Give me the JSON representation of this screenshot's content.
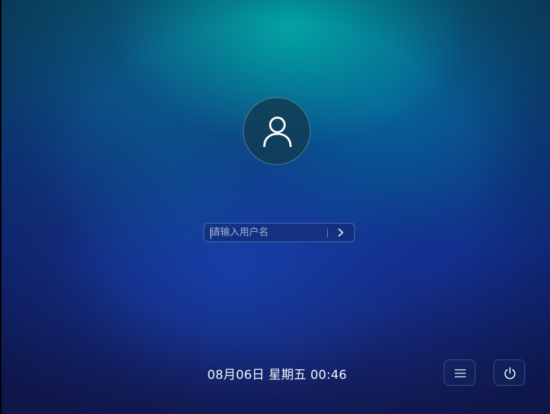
{
  "login": {
    "username_placeholder": "请输入用户名",
    "username_value": ""
  },
  "clock": {
    "datetime": "08月06日 星期五 00:46"
  },
  "icons": {
    "avatar": "user-icon",
    "submit": "chevron-right-icon",
    "menu": "menu-icon",
    "power": "power-icon"
  }
}
